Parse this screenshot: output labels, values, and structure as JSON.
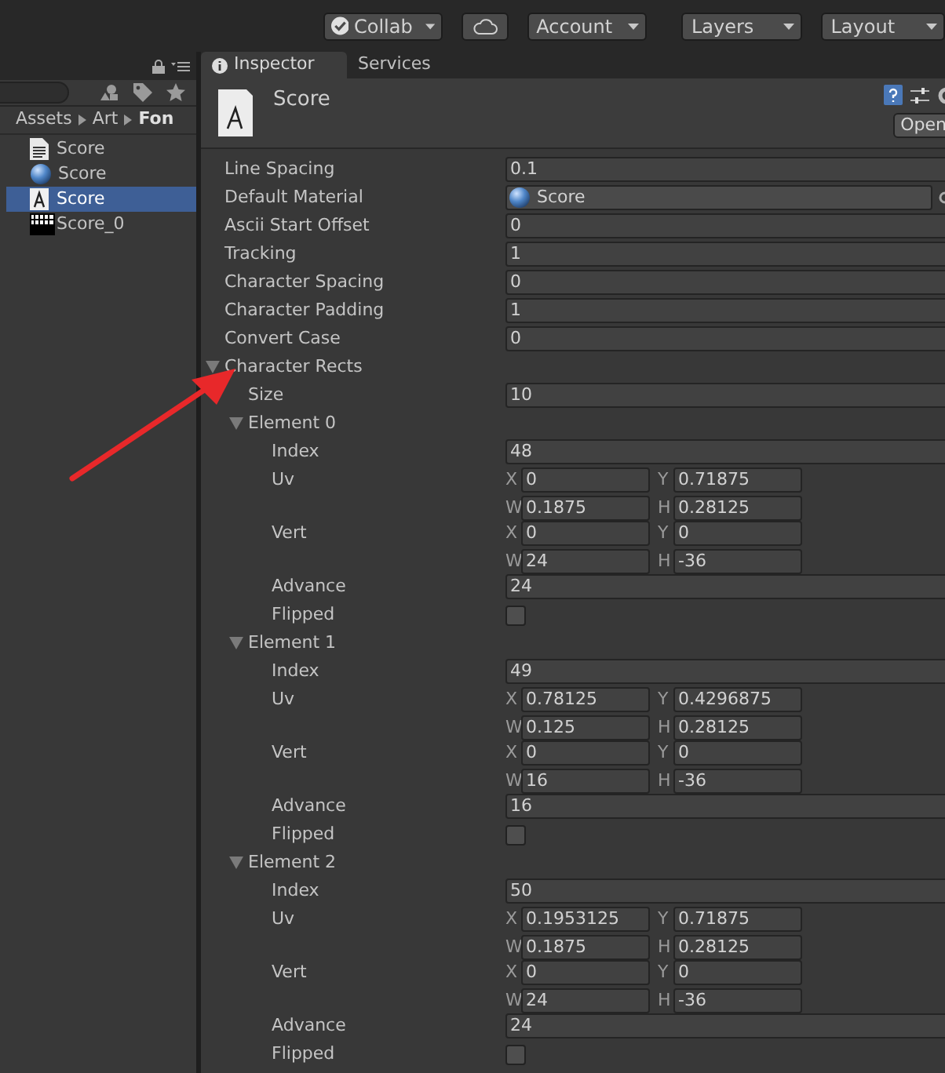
{
  "toolbar": {
    "collab": "Collab",
    "account": "Account",
    "layers": "Layers",
    "layout": "Layout"
  },
  "project": {
    "breadcrumb": [
      {
        "label": "Assets",
        "current": false
      },
      {
        "label": "Art",
        "current": false
      },
      {
        "label": "Fon",
        "current": true
      }
    ],
    "items": [
      {
        "label": "Score",
        "kind": "text-asset",
        "selected": false
      },
      {
        "label": "Score",
        "kind": "material",
        "selected": false
      },
      {
        "label": "Score",
        "kind": "font",
        "selected": true
      },
      {
        "label": "Score_0",
        "kind": "sprite",
        "selected": false
      }
    ]
  },
  "inspector": {
    "tabs": [
      {
        "label": "Inspector",
        "selected": true
      },
      {
        "label": "Services",
        "selected": false
      }
    ],
    "title": "Score",
    "open_button": "Open",
    "properties": [
      {
        "label": "Line Spacing",
        "kind": "field",
        "value": "0.1"
      },
      {
        "label": "Default Material",
        "kind": "object",
        "value": "Score"
      },
      {
        "label": "Ascii Start Offset",
        "kind": "field",
        "value": "0"
      },
      {
        "label": "Tracking",
        "kind": "field",
        "value": "1"
      },
      {
        "label": "Character Spacing",
        "kind": "field",
        "value": "0"
      },
      {
        "label": "Character Padding",
        "kind": "field",
        "value": "1"
      },
      {
        "label": "Convert Case",
        "kind": "field",
        "value": "0"
      }
    ],
    "character_rects": {
      "label": "Character Rects",
      "expanded": true,
      "size_label": "Size",
      "size": "10",
      "elements": [
        {
          "label": "Element 0",
          "expanded": true,
          "fields": [
            {
              "kind": "field",
              "label": "Index",
              "value": "48"
            },
            {
              "kind": "rect",
              "label": "Uv",
              "components": [
                {
                  "label": "X",
                  "value": "0"
                },
                {
                  "label": "Y",
                  "value": "0.71875"
                },
                {
                  "label": "W",
                  "value": "0.1875"
                },
                {
                  "label": "H",
                  "value": "0.28125"
                }
              ]
            },
            {
              "kind": "rect",
              "label": "Vert",
              "components": [
                {
                  "label": "X",
                  "value": "0"
                },
                {
                  "label": "Y",
                  "value": "0"
                },
                {
                  "label": "W",
                  "value": "24"
                },
                {
                  "label": "H",
                  "value": "-36"
                }
              ]
            },
            {
              "kind": "field",
              "label": "Advance",
              "value": "24"
            },
            {
              "kind": "toggle",
              "label": "Flipped",
              "checked": false
            }
          ]
        },
        {
          "label": "Element 1",
          "expanded": true,
          "fields": [
            {
              "kind": "field",
              "label": "Index",
              "value": "49"
            },
            {
              "kind": "rect",
              "label": "Uv",
              "components": [
                {
                  "label": "X",
                  "value": "0.78125"
                },
                {
                  "label": "Y",
                  "value": "0.4296875"
                },
                {
                  "label": "W",
                  "value": "0.125"
                },
                {
                  "label": "H",
                  "value": "0.28125"
                }
              ]
            },
            {
              "kind": "rect",
              "label": "Vert",
              "components": [
                {
                  "label": "X",
                  "value": "0"
                },
                {
                  "label": "Y",
                  "value": "0"
                },
                {
                  "label": "W",
                  "value": "16"
                },
                {
                  "label": "H",
                  "value": "-36"
                }
              ]
            },
            {
              "kind": "field",
              "label": "Advance",
              "value": "16"
            },
            {
              "kind": "toggle",
              "label": "Flipped",
              "checked": false
            }
          ]
        },
        {
          "label": "Element 2",
          "expanded": true,
          "fields": [
            {
              "kind": "field",
              "label": "Index",
              "value": "50"
            },
            {
              "kind": "rect",
              "label": "Uv",
              "components": [
                {
                  "label": "X",
                  "value": "0.1953125"
                },
                {
                  "label": "Y",
                  "value": "0.71875"
                },
                {
                  "label": "W",
                  "value": "0.1875"
                },
                {
                  "label": "H",
                  "value": "0.28125"
                }
              ]
            },
            {
              "kind": "rect",
              "label": "Vert",
              "components": [
                {
                  "label": "X",
                  "value": "0"
                },
                {
                  "label": "Y",
                  "value": "0"
                },
                {
                  "label": "W",
                  "value": "24"
                },
                {
                  "label": "H",
                  "value": "-36"
                }
              ]
            },
            {
              "kind": "field",
              "label": "Advance",
              "value": "24"
            },
            {
              "kind": "toggle",
              "label": "Flipped",
              "checked": false
            }
          ]
        }
      ]
    }
  }
}
